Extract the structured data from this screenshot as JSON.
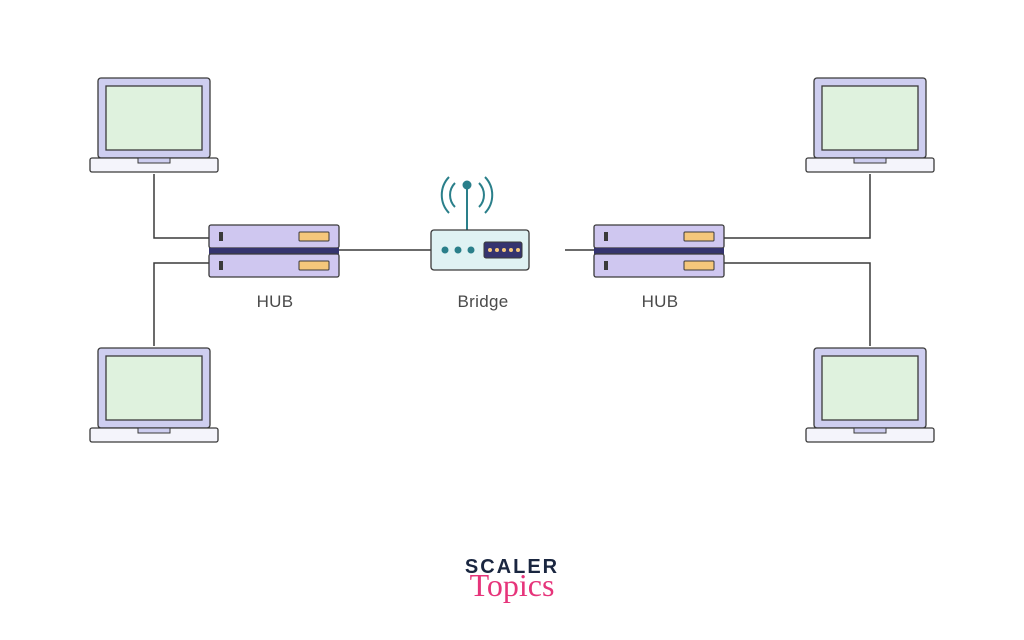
{
  "diagram": {
    "labels": {
      "hub_left": "HUB",
      "bridge": "Bridge",
      "hub_right": "HUB"
    },
    "devices": [
      {
        "id": "laptop-top-left",
        "type": "laptop"
      },
      {
        "id": "laptop-bottom-left",
        "type": "laptop"
      },
      {
        "id": "laptop-top-right",
        "type": "laptop"
      },
      {
        "id": "laptop-bottom-right",
        "type": "laptop"
      },
      {
        "id": "hub-left",
        "type": "hub"
      },
      {
        "id": "hub-right",
        "type": "hub"
      },
      {
        "id": "bridge",
        "type": "bridge"
      }
    ],
    "connections": [
      {
        "from": "laptop-top-left",
        "to": "hub-left"
      },
      {
        "from": "laptop-bottom-left",
        "to": "hub-left"
      },
      {
        "from": "laptop-top-right",
        "to": "hub-right"
      },
      {
        "from": "laptop-bottom-right",
        "to": "hub-right"
      },
      {
        "from": "hub-left",
        "to": "bridge"
      },
      {
        "from": "hub-right",
        "to": "bridge"
      }
    ]
  },
  "colors": {
    "laptop_body": "#cecef0",
    "laptop_screen": "#dff2de",
    "hub_body": "#cfc7f0",
    "hub_slot": "#f5c77b",
    "hub_divider": "#35346f",
    "bridge_body": "#dff2f3",
    "bridge_led": "#2a7f8a",
    "bridge_slot_bg": "#35346f",
    "bridge_slot_dot": "#f5c77b",
    "stroke": "#3a3a3a",
    "wire": "#3a3a3a"
  },
  "branding": {
    "line1": "SCALER",
    "line2": "Topics"
  }
}
